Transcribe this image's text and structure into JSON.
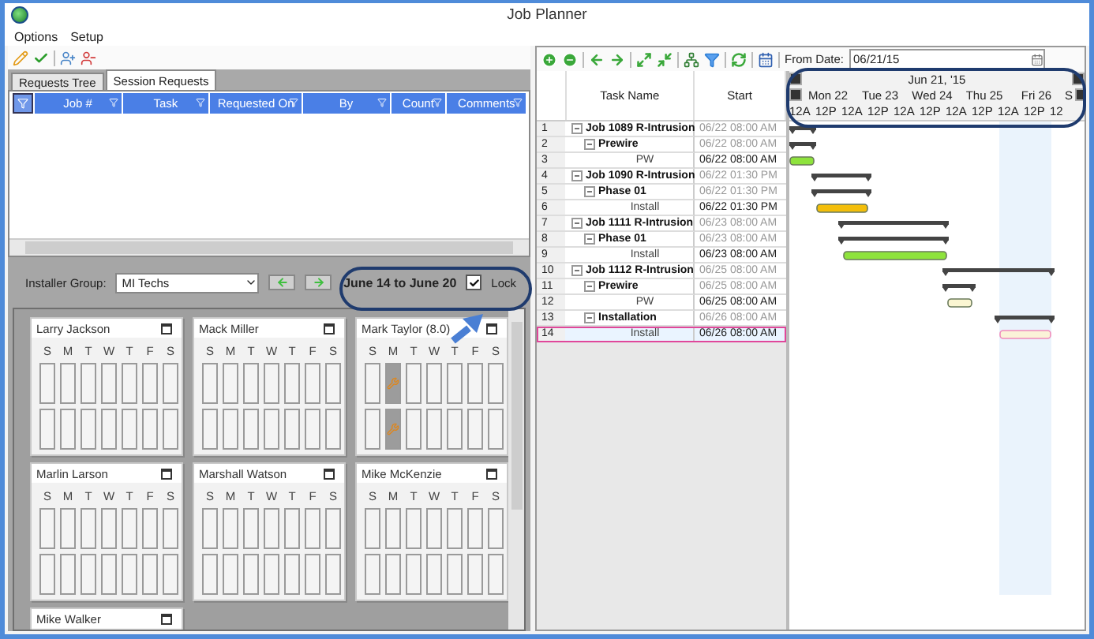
{
  "window": {
    "title": "Job Planner"
  },
  "menu": [
    {
      "label": "Options"
    },
    {
      "label": "Setup"
    }
  ],
  "requests": {
    "tabs": [
      {
        "label": "Requests Tree",
        "selected": false
      },
      {
        "label": "Session Requests",
        "selected": true
      }
    ],
    "columns": [
      "Job #",
      "Task",
      "Requested On",
      "By",
      "Count",
      "Comments"
    ]
  },
  "installers": {
    "group_label": "Installer Group:",
    "group_value": "MI Techs",
    "week": "June 14 to June 20",
    "lock": {
      "label": "Lock",
      "checked": true
    },
    "cards": [
      {
        "name": "Larry Jackson",
        "days": [
          {
            "label": "S",
            "booked": false
          },
          {
            "label": "M",
            "booked": false
          },
          {
            "label": "T",
            "booked": false
          },
          {
            "label": "W",
            "booked": false
          },
          {
            "label": "T",
            "booked": false
          },
          {
            "label": "F",
            "booked": false
          },
          {
            "label": "S",
            "booked": false
          }
        ]
      },
      {
        "name": "Mack Miller",
        "days": [
          {
            "label": "S",
            "booked": false
          },
          {
            "label": "M",
            "booked": false
          },
          {
            "label": "T",
            "booked": false
          },
          {
            "label": "W",
            "booked": false
          },
          {
            "label": "T",
            "booked": false
          },
          {
            "label": "F",
            "booked": false
          },
          {
            "label": "S",
            "booked": false
          }
        ]
      },
      {
        "name": "Mark Taylor  (8.0)",
        "days": [
          {
            "label": "S",
            "booked": false
          },
          {
            "label": "M",
            "booked": true
          },
          {
            "label": "T",
            "booked": false
          },
          {
            "label": "W",
            "booked": false
          },
          {
            "label": "T",
            "booked": false
          },
          {
            "label": "F",
            "booked": false
          },
          {
            "label": "S",
            "booked": false
          }
        ]
      },
      {
        "name": "Marlin Larson",
        "days": [
          {
            "label": "S",
            "booked": false
          },
          {
            "label": "M",
            "booked": false
          },
          {
            "label": "T",
            "booked": false
          },
          {
            "label": "W",
            "booked": false
          },
          {
            "label": "T",
            "booked": false
          },
          {
            "label": "F",
            "booked": false
          },
          {
            "label": "S",
            "booked": false
          }
        ]
      },
      {
        "name": "Marshall Watson",
        "days": [
          {
            "label": "S",
            "booked": false
          },
          {
            "label": "M",
            "booked": false
          },
          {
            "label": "T",
            "booked": false
          },
          {
            "label": "W",
            "booked": false
          },
          {
            "label": "T",
            "booked": false
          },
          {
            "label": "F",
            "booked": false
          },
          {
            "label": "S",
            "booked": false
          }
        ]
      },
      {
        "name": "Mike McKenzie",
        "days": [
          {
            "label": "S",
            "booked": false
          },
          {
            "label": "M",
            "booked": false
          },
          {
            "label": "T",
            "booked": false
          },
          {
            "label": "W",
            "booked": false
          },
          {
            "label": "T",
            "booked": false
          },
          {
            "label": "F",
            "booked": false
          },
          {
            "label": "S",
            "booked": false
          }
        ]
      },
      {
        "name": "Mike Walker"
      }
    ]
  },
  "planner": {
    "from_date": {
      "label": "From Date:",
      "value": "06/21/15"
    },
    "columns": [
      "Task Name",
      "Start"
    ],
    "timeline": {
      "month": "Jun 21, '15",
      "days": [
        "Mon 22",
        "Tue 23",
        "Wed 24",
        "Thu 25",
        "Fri 26",
        "S"
      ],
      "hours": [
        "12A",
        "12P",
        "12A",
        "12P",
        "12A",
        "12P",
        "12A",
        "12P",
        "12A",
        "12P",
        "12"
      ]
    },
    "rows": [
      {
        "number": "1",
        "name": "Job 1089 R-Intrusion",
        "start": "06/22 08:00 AM",
        "kind": "summary",
        "expanded": true,
        "selected": false,
        "children": [
          {
            "number": "2",
            "name": "Prewire",
            "start": "06/22 08:00 AM",
            "kind": "summary",
            "expanded": true,
            "selected": false,
            "children": [
              {
                "number": "3",
                "name": "PW",
                "start": "06/22 08:00 AM",
                "kind": "task",
                "selected": false
              }
            ]
          }
        ]
      },
      {
        "number": "4",
        "name": "Job 1090 R-Intrusion",
        "start": "06/22 01:30 PM",
        "kind": "summary",
        "expanded": true,
        "selected": false,
        "children": [
          {
            "number": "5",
            "name": "Phase 01",
            "start": "06/22 01:30 PM",
            "kind": "summary",
            "expanded": true,
            "selected": false,
            "children": [
              {
                "number": "6",
                "name": "Install",
                "start": "06/22 01:30 PM",
                "kind": "task",
                "selected": false
              }
            ]
          }
        ]
      },
      {
        "number": "7",
        "name": "Job 1111 R-Intrusion",
        "start": "06/23 08:00 AM",
        "kind": "summary",
        "expanded": true,
        "selected": false,
        "children": [
          {
            "number": "8",
            "name": "Phase 01",
            "start": "06/23 08:00 AM",
            "kind": "summary",
            "expanded": true,
            "selected": false,
            "children": [
              {
                "number": "9",
                "name": "Install",
                "start": "06/23 08:00 AM",
                "kind": "task",
                "selected": false
              }
            ]
          }
        ]
      },
      {
        "number": "10",
        "name": "Job 1112 R-Intrusion",
        "start": "06/25 08:00 AM",
        "kind": "summary",
        "expanded": true,
        "selected": false,
        "children": [
          {
            "number": "11",
            "name": "Prewire",
            "start": "06/25 08:00 AM",
            "kind": "summary",
            "expanded": true,
            "selected": false,
            "children": [
              {
                "number": "12",
                "name": "PW",
                "start": "06/25 08:00 AM",
                "kind": "task",
                "selected": false
              }
            ]
          },
          {
            "number": "13",
            "name": "Installation",
            "start": "06/26 08:00 AM",
            "kind": "summary",
            "expanded": true,
            "selected": false,
            "children": [
              {
                "number": "14",
                "name": "Install",
                "start": "06/26 08:00 AM",
                "kind": "task",
                "selected": true
              }
            ]
          }
        ]
      }
    ]
  }
}
